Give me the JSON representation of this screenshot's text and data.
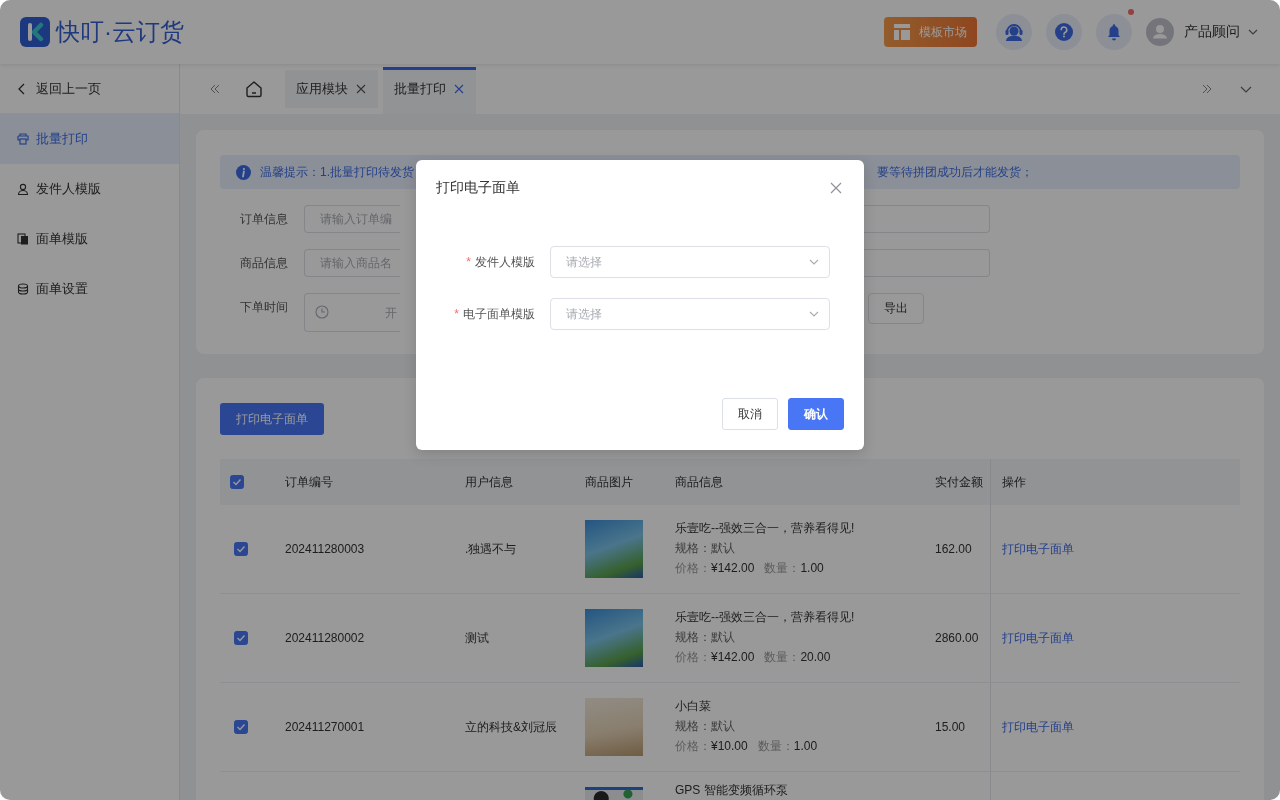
{
  "header": {
    "logo_text": "快叮·云订货",
    "market_button": "模板市场",
    "has_unread": true,
    "user_name": "产品顾问"
  },
  "sidebar": {
    "back_link": "返回上一页",
    "items": [
      {
        "label": "批量打印",
        "selected": true
      },
      {
        "label": "发件人模版",
        "selected": false
      },
      {
        "label": "面单模版",
        "selected": false
      },
      {
        "label": "面单设置",
        "selected": false
      }
    ]
  },
  "tabs": [
    {
      "label": "应用模块",
      "selected": false
    },
    {
      "label": "批量打印",
      "selected": true
    }
  ],
  "notice": {
    "text_left": "温馨提示：1.批量打印待发货",
    "text_right": "要等待拼团成功后才能发货；"
  },
  "filters": [
    {
      "label": "订单信息",
      "kind": "text",
      "placeholder": "请输入订单编"
    },
    {
      "label": "商品信息",
      "kind": "text",
      "placeholder": "请输入商品名"
    },
    {
      "label": "下单时间",
      "kind": "date_range",
      "placeholder": "开"
    }
  ],
  "export_button": "导出",
  "print_button": "打印电子面单",
  "table": {
    "all_checked": true,
    "columns": [
      "订单编号",
      "用户信息",
      "商品图片",
      "商品信息",
      "实付金额",
      "操作"
    ],
    "rows": [
      {
        "checked": true,
        "order_no": "202411280003",
        "user": ".独遇不与",
        "product_name": "乐壹吃--强效三合一，营养看得见!",
        "spec": "规格：默认",
        "price_label": "价格：",
        "price": "¥142.00",
        "qty_label": "数量：",
        "qty": "1.00",
        "amount": "162.00",
        "action": "打印电子面单"
      },
      {
        "checked": true,
        "order_no": "202411280002",
        "user": "测试",
        "product_name": "乐壹吃--强效三合一，营养看得见!",
        "spec": "规格：默认",
        "price_label": "价格：",
        "price": "¥142.00",
        "qty_label": "数量：",
        "qty": "20.00",
        "amount": "2860.00",
        "action": "打印电子面单"
      },
      {
        "checked": true,
        "order_no": "202411270001",
        "user": "立的科技&刘冠辰",
        "product_name": "小白菜",
        "spec": "规格：默认",
        "price_label": "价格：",
        "price": "¥10.00",
        "qty_label": "数量：",
        "qty": "1.00",
        "amount": "15.00",
        "action": "打印电子面单"
      },
      {
        "product_name": "GPS 智能变频循环泵"
      }
    ]
  },
  "dialog": {
    "title": "打印电子面单",
    "fields": [
      {
        "required_mark": "*",
        "label": "发件人模版",
        "placeholder": "请选择"
      },
      {
        "required_mark": "*",
        "label": "电子面单模版",
        "placeholder": "请选择"
      }
    ],
    "buttons": [
      {
        "label": "取消",
        "kind": "default"
      },
      {
        "label": "确认",
        "kind": "primary"
      }
    ]
  }
}
